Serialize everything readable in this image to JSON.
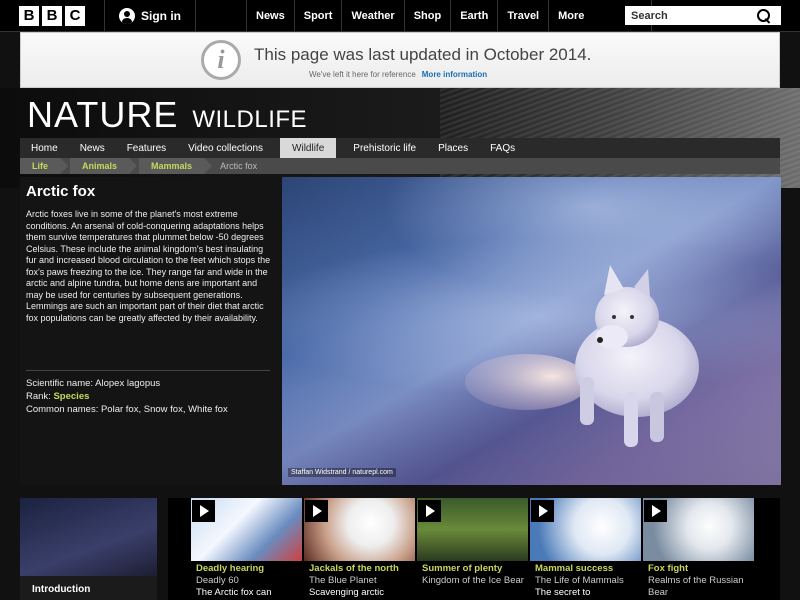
{
  "topbar": {
    "logo_letters": [
      "B",
      "B",
      "C"
    ],
    "signin_label": "Sign in",
    "nav": [
      "News",
      "Sport",
      "Weather",
      "Shop",
      "Earth",
      "Travel"
    ],
    "more_label": "More",
    "search_placeholder": "Search"
  },
  "banner": {
    "title": "This page was last updated in October 2014.",
    "subtitle": "We've left it here for reference",
    "link": "More information"
  },
  "header": {
    "title": "NATURE",
    "subtitle": "WILDLIFE"
  },
  "section_nav": {
    "items": [
      "Home",
      "News",
      "Features",
      "Video collections",
      "Wildlife",
      "Prehistoric life",
      "Places",
      "FAQs"
    ],
    "active": "Wildlife"
  },
  "breadcrumbs": {
    "items": [
      "Life",
      "Animals",
      "Mammals"
    ],
    "current": "Arctic fox"
  },
  "species": {
    "name": "Arctic fox",
    "description": "Arctic foxes live in some of the planet's most extreme conditions. An arsenal of cold-conquering adaptations helps them survive temperatures that plummet below -50 degrees Celsius. These include the animal kingdom's best insulating fur and increased blood circulation to the feet which stops the fox's paws freezing to the ice. They range far and wide in the arctic and alpine tundra, but home dens are important and may be used for centuries by subsequent generations. Lemmings are such an important part of their diet that arctic fox populations can be greatly affected by their availability.",
    "scientific_name": "Scientific name: Alopex lagopus",
    "rank_label": "Rank:",
    "rank_value": "Species",
    "common_names": "Common names: Polar fox, Snow fox, White fox"
  },
  "photo": {
    "credit": "Staffan Widstrand / naturepl.com"
  },
  "intro": {
    "label": "Introduction"
  },
  "clips": [
    {
      "title": "Deadly hearing",
      "source": "Deadly 60",
      "snippet": "The Arctic fox can"
    },
    {
      "title": "Jackals of the north",
      "source": "The Blue Planet",
      "snippet": "Scavenging arctic"
    },
    {
      "title": "Summer of plenty",
      "source": "Kingdom of the Ice Bear",
      "snippet": ""
    },
    {
      "title": "Mammal success",
      "source": "The Life of Mammals",
      "snippet": "The secret to"
    },
    {
      "title": "Fox fight",
      "source": "Realms of the Russian Bear",
      "snippet": ""
    }
  ],
  "colors": {
    "accent": "#c8d85a",
    "link": "#1a6fb3"
  }
}
